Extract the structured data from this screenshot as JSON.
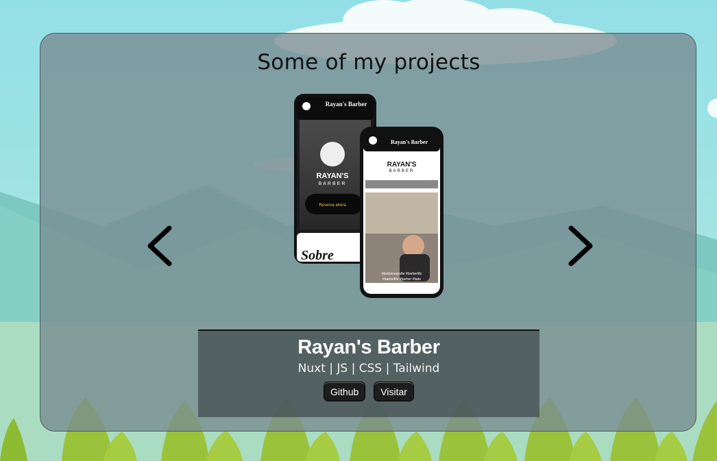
{
  "section": {
    "title": "Some of my projects"
  },
  "carousel": {
    "prev_icon": "chevron-left-icon",
    "next_icon": "chevron-right-icon"
  },
  "project": {
    "name": "Rayan's Barber",
    "tech": "Nuxt | JS | CSS | Tailwind",
    "github_label": "Github",
    "visit_label": "Visitar",
    "screenshot": {
      "back_phone_header": "Rayan's Barber",
      "back_phone_brand": "RAYAN'S",
      "back_phone_brand_sub": "BARBER",
      "back_phone_cta": "Reserva ahora",
      "back_phone_section": "Sobre",
      "front_phone_header": "Rayan's Barber",
      "front_phone_brand": "RAYAN'S",
      "front_phone_brand_sub": "BARBER",
      "front_phone_caption_1": "#barberespaña #barberlife",
      "front_phone_caption_2": "#barberlife #barber #fade"
    }
  },
  "colors": {
    "sky": "#93dfe6",
    "card_bg": "#788c91",
    "info_bg": "#485456",
    "button_bg": "#1d1d1d",
    "title_text": "#111111"
  }
}
